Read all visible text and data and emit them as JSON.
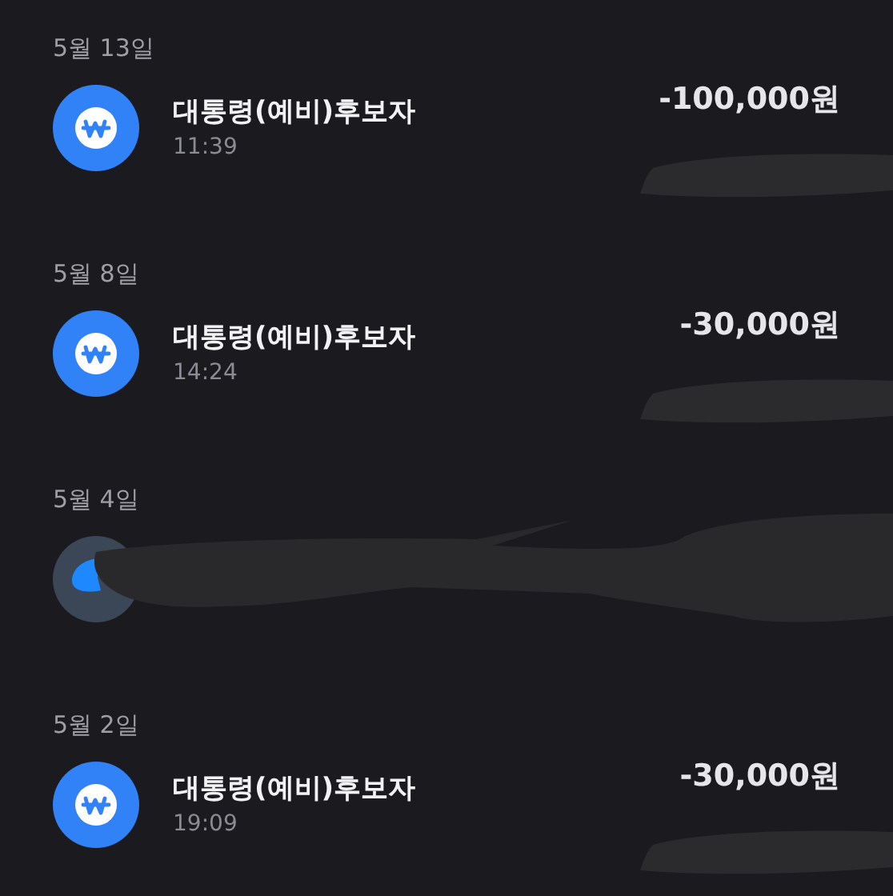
{
  "groups": [
    {
      "date": "5월 13일",
      "entries": [
        {
          "kind": "transfer",
          "title": "대통령(예비)후보자",
          "time": "11:39",
          "amount": "-100,000원",
          "balance_redacted": true
        }
      ]
    },
    {
      "date": "5월 8일",
      "entries": [
        {
          "kind": "transfer",
          "title": "대통령(예비)후보자",
          "time": "14:24",
          "amount": "-30,000원",
          "balance_redacted": true
        }
      ]
    },
    {
      "date": "5월 4일",
      "entries": [
        {
          "kind": "redacted",
          "balance_redacted": true
        }
      ]
    },
    {
      "date": "5월 2일",
      "entries": [
        {
          "kind": "transfer",
          "title": "대통령(예비)후보자",
          "time": "19:09",
          "amount": "-30,000원",
          "balance_redacted": true
        }
      ]
    }
  ]
}
